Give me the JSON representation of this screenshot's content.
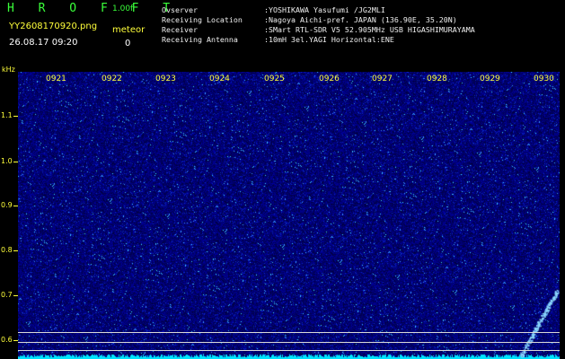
{
  "header": {
    "app_name": "H R O F F T",
    "version": "1.00f",
    "filename": "YY2608170920.png",
    "datetime": "26.08.17 09:20",
    "meteor_label": "meteor",
    "meteor_count": "0"
  },
  "info": [
    {
      "key": "Ovserver",
      "value": ":YOSHIKAWA Yasufumi /JG2MLI"
    },
    {
      "key": "Receiving Location",
      "value": ":Nagoya Aichi-pref. JAPAN (136.90E, 35.20N)"
    },
    {
      "key": "Receiver",
      "value": ":SMart RTL-SDR V5 52.905MHz USB HIGASHIMURAYAMA"
    },
    {
      "key": "Receiving Antenna",
      "value": ":10mH 3el.YAGI Horizontal:ENE"
    }
  ],
  "axis": {
    "y_unit": "kHz",
    "y_ticks": [
      "1.1",
      "1.0",
      "0.9",
      "0.8",
      "0.7",
      "0.6"
    ],
    "x_ticks": [
      "0921",
      "0922",
      "0923",
      "0924",
      "0925",
      "0926",
      "0927",
      "0928",
      "0929",
      "0930"
    ]
  },
  "colors": {
    "background": "#000000",
    "spectrogram": "#000050",
    "noise_floor": "#00e5ff",
    "label_yellow": "#ffff3a",
    "brand_green": "#3aff3a"
  }
}
